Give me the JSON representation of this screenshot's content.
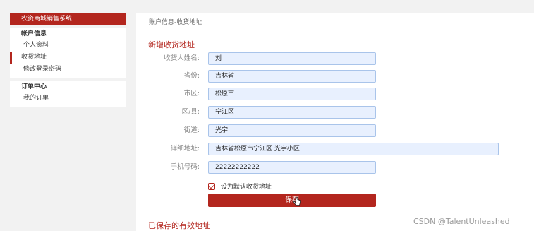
{
  "sidebar": {
    "header": "农资商城销售系统",
    "sections": [
      {
        "title": "帐户信息",
        "items": [
          {
            "label": "个人资料",
            "active": false
          },
          {
            "label": "收货地址",
            "active": true
          },
          {
            "label": "修改登录密码",
            "active": false
          }
        ]
      },
      {
        "title": "订单中心",
        "items": [
          {
            "label": "我的订单",
            "active": false
          }
        ]
      }
    ]
  },
  "breadcrumb": "账户信息-收货地址",
  "form": {
    "title": "新增收货地址",
    "fields": [
      {
        "label": "收货人姓名:",
        "value": "刘"
      },
      {
        "label": "省份:",
        "value": "吉林省"
      },
      {
        "label": "市区:",
        "value": "松原市"
      },
      {
        "label": "区/县:",
        "value": "宁江区"
      },
      {
        "label": "街道:",
        "value": "光宇"
      },
      {
        "label": "详细地址:",
        "value": "吉林省松原市宁江区 光宇小区"
      },
      {
        "label": "手机号码:",
        "value": "22222222222"
      }
    ],
    "default_checkbox_label": "设为默认收货地址",
    "default_checked": true,
    "save_label": "保存"
  },
  "saved_title": "已保存的有效地址",
  "watermark": "CSDN @TalentUnleashed",
  "colors": {
    "accent": "#b3261e",
    "field_bg": "#e8f0fe"
  }
}
